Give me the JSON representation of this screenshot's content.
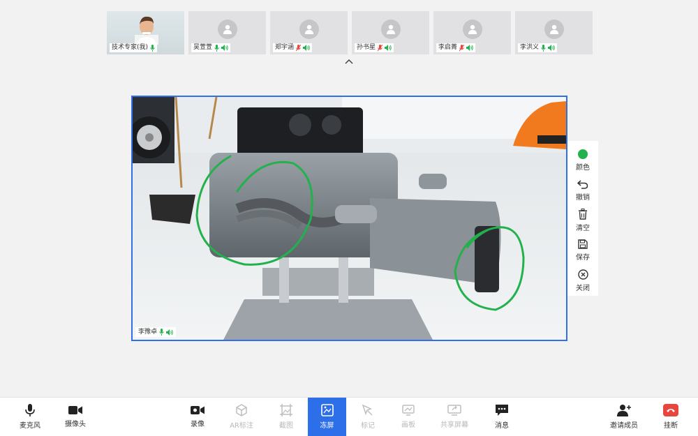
{
  "participants": [
    {
      "name": "技术专家(我)",
      "mic": "on",
      "speaker": "on",
      "self": true
    },
    {
      "name": "吴萱萱",
      "mic": "on",
      "speaker": "on"
    },
    {
      "name": "郑宇涵",
      "mic": "muted",
      "speaker": "on"
    },
    {
      "name": "孙书星",
      "mic": "muted",
      "speaker": "on"
    },
    {
      "name": "李启菁",
      "mic": "muted",
      "speaker": "on"
    },
    {
      "name": "李洪义",
      "mic": "on",
      "speaker": "on"
    }
  ],
  "main_video": {
    "speaker_name": "李豫卓",
    "border_color": "#2f6fe8",
    "annotation_color": "#22b14c"
  },
  "sidebar": {
    "color_label": "颜色",
    "undo_label": "撤销",
    "clear_label": "清空",
    "save_label": "保存",
    "close_label": "关闭",
    "selected_color": "#22b14c"
  },
  "toolbar": {
    "mic_label": "麦克风",
    "camera_label": "摄像头",
    "record_label": "录像",
    "ar_label": "AR标注",
    "screenshot_label": "截图",
    "freeze_label": "冻屏",
    "mark_label": "标记",
    "board_label": "画板",
    "share_label": "共享屏幕",
    "message_label": "消息",
    "invite_label": "邀请成员",
    "hangup_label": "挂断",
    "accent_color": "#2d6fe9",
    "hangup_color": "#e8453c"
  }
}
